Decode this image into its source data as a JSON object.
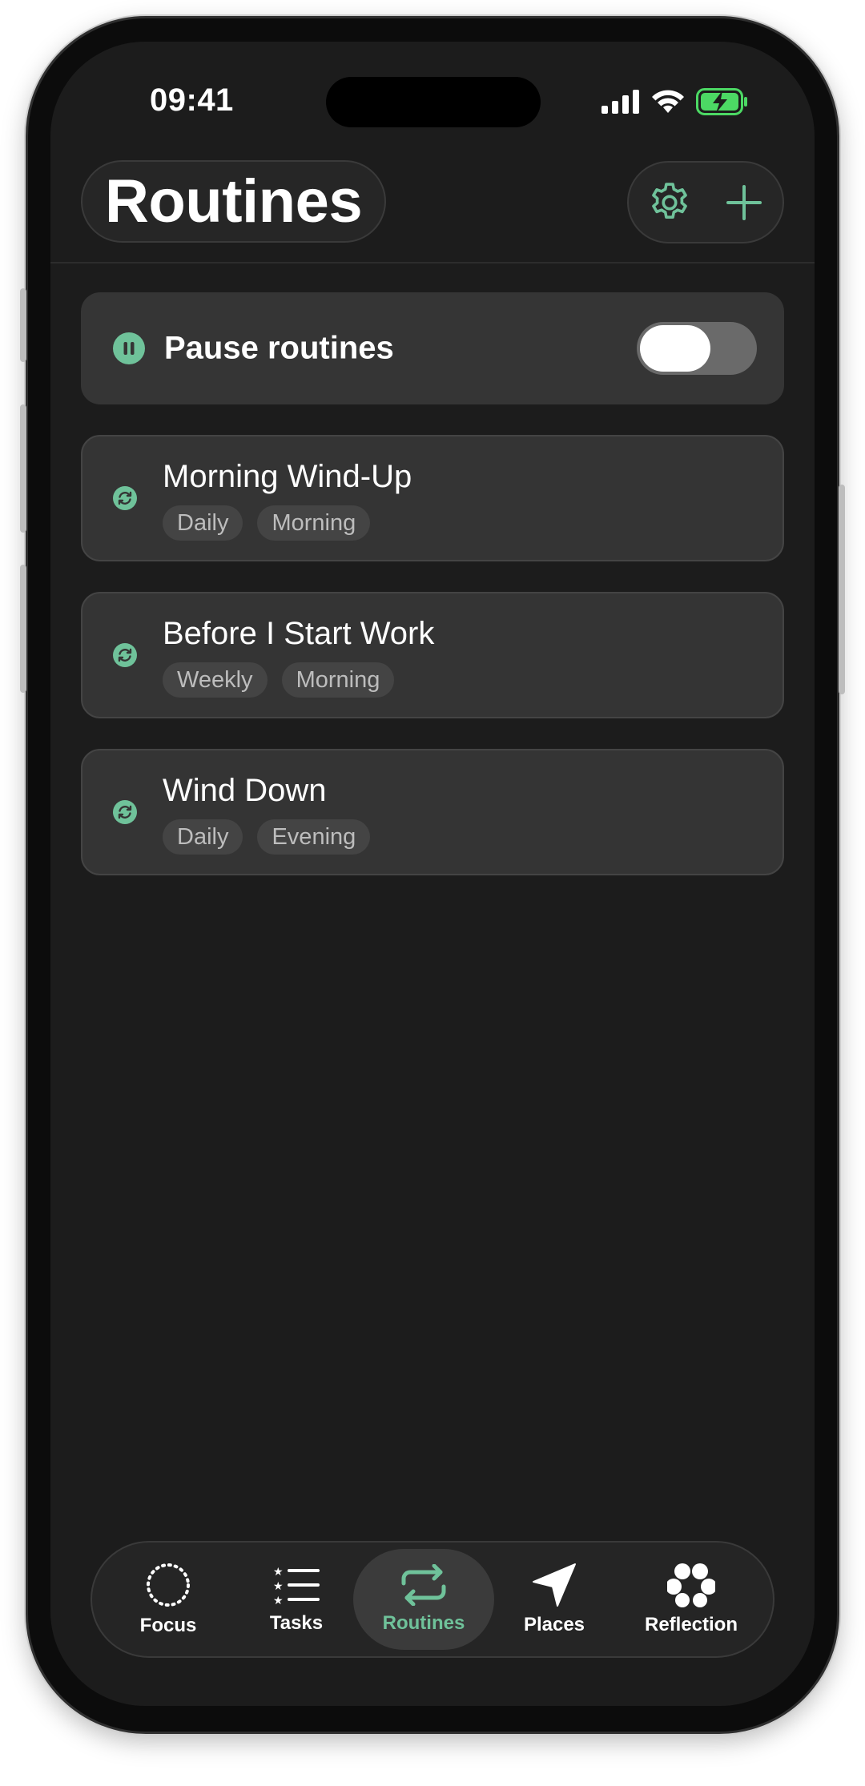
{
  "status_bar": {
    "time": "09:41"
  },
  "header": {
    "title": "Routines",
    "settings_icon": "gear-icon",
    "add_icon": "plus-icon"
  },
  "pause": {
    "label": "Pause routines",
    "enabled": false
  },
  "routines": [
    {
      "title": "Morning Wind-Up",
      "tags": [
        "Daily",
        "Morning"
      ]
    },
    {
      "title": "Before I Start Work",
      "tags": [
        "Weekly",
        "Morning"
      ]
    },
    {
      "title": "Wind Down",
      "tags": [
        "Daily",
        "Evening"
      ]
    }
  ],
  "tabs": [
    {
      "label": "Focus",
      "icon": "dotted-circle-icon",
      "active": false
    },
    {
      "label": "Tasks",
      "icon": "list-icon",
      "active": false
    },
    {
      "label": "Routines",
      "icon": "repeat-icon",
      "active": true
    },
    {
      "label": "Places",
      "icon": "location-arrow-icon",
      "active": false
    },
    {
      "label": "Reflection",
      "icon": "flower-icon",
      "active": false
    }
  ],
  "colors": {
    "accent": "#6fc29a",
    "background": "#1c1c1c",
    "card": "#353535",
    "battery": "#4cd964"
  }
}
